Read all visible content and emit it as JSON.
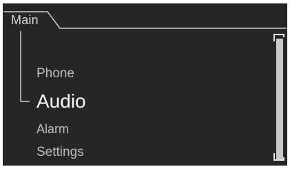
{
  "tab": {
    "label": "Main"
  },
  "menu": {
    "items": [
      {
        "label": "Phone"
      },
      {
        "label": "Audio",
        "selected": true
      },
      {
        "label": "Alarm"
      },
      {
        "label": "Settings"
      }
    ]
  },
  "scrollbar": {
    "thumb_fraction": 1.0,
    "position_fraction": 0.0
  },
  "colors": {
    "background": "#262626",
    "selected_text": "#ffffff",
    "normal_text": "#bdbdbd",
    "lines": "#cfcfcf"
  }
}
